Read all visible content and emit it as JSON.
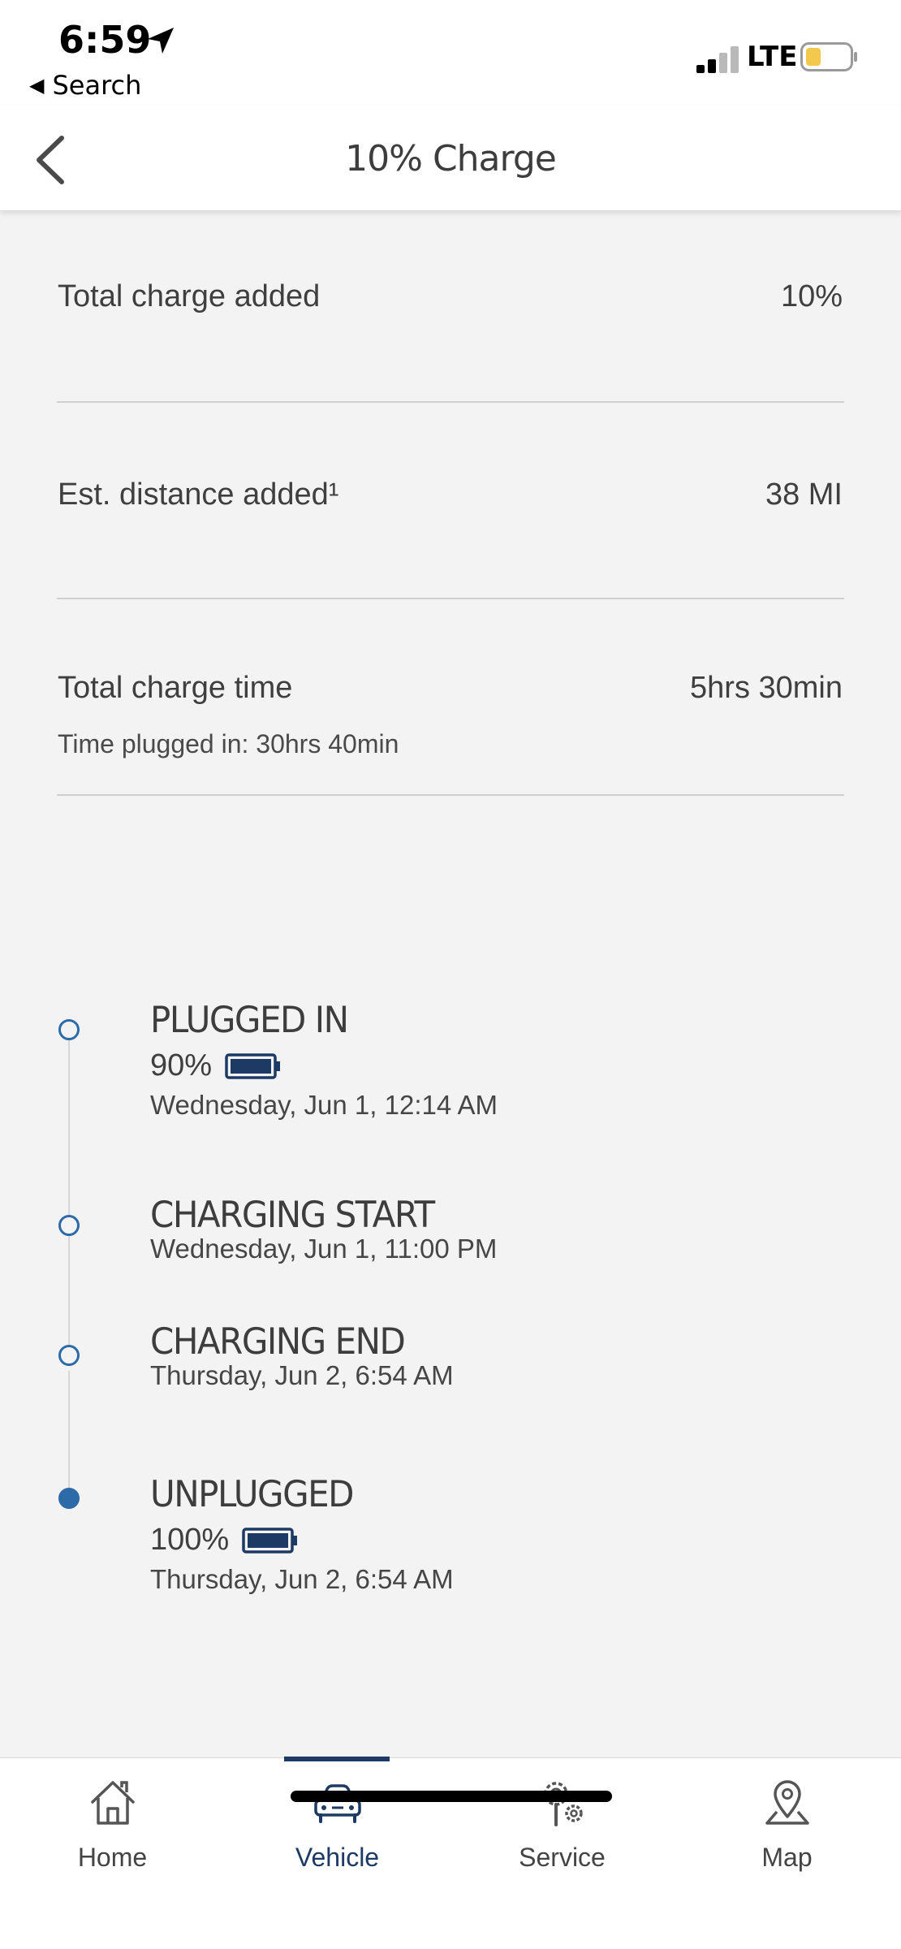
{
  "status_bar": {
    "time": "6:59",
    "back_app_label": "Search",
    "network": "LTE",
    "icons": [
      "location-arrow-icon",
      "signal-icon",
      "battery-icon"
    ]
  },
  "header": {
    "title": "10% Charge",
    "back_icon": "chevron-left-icon"
  },
  "summary": {
    "total_charge_added": {
      "label": "Total charge added",
      "value": "10%"
    },
    "est_distance_added": {
      "label": "Est. distance added¹",
      "value": "38 MI"
    },
    "total_charge_time": {
      "label": "Total charge time",
      "value": "5hrs 30min",
      "sub": "Time plugged in: 30hrs 40min"
    }
  },
  "timeline": [
    {
      "title": "PLUGGED IN",
      "percent": "90%",
      "date": "Wednesday, Jun 1, 12:14 AM",
      "filled": false
    },
    {
      "title": "CHARGING START",
      "date": "Wednesday, Jun 1, 11:00 PM",
      "filled": false
    },
    {
      "title": "CHARGING END",
      "date": "Thursday, Jun 2, 6:54 AM",
      "filled": false
    },
    {
      "title": "UNPLUGGED",
      "percent": "100%",
      "date": "Thursday, Jun 2, 6:54 AM",
      "filled": true
    }
  ],
  "bottom_nav": [
    {
      "label": "Home",
      "icon": "home-icon",
      "active": false
    },
    {
      "label": "Vehicle",
      "icon": "car-icon",
      "active": true
    },
    {
      "label": "Service",
      "icon": "service-gears-icon",
      "active": false
    },
    {
      "label": "Map",
      "icon": "map-pin-icon",
      "active": false
    }
  ],
  "colors": {
    "accent": "#1c3a63",
    "timeline_dot": "#2d6aa8",
    "background": "#f3f3f4",
    "battery_low": "#f2c94c"
  }
}
